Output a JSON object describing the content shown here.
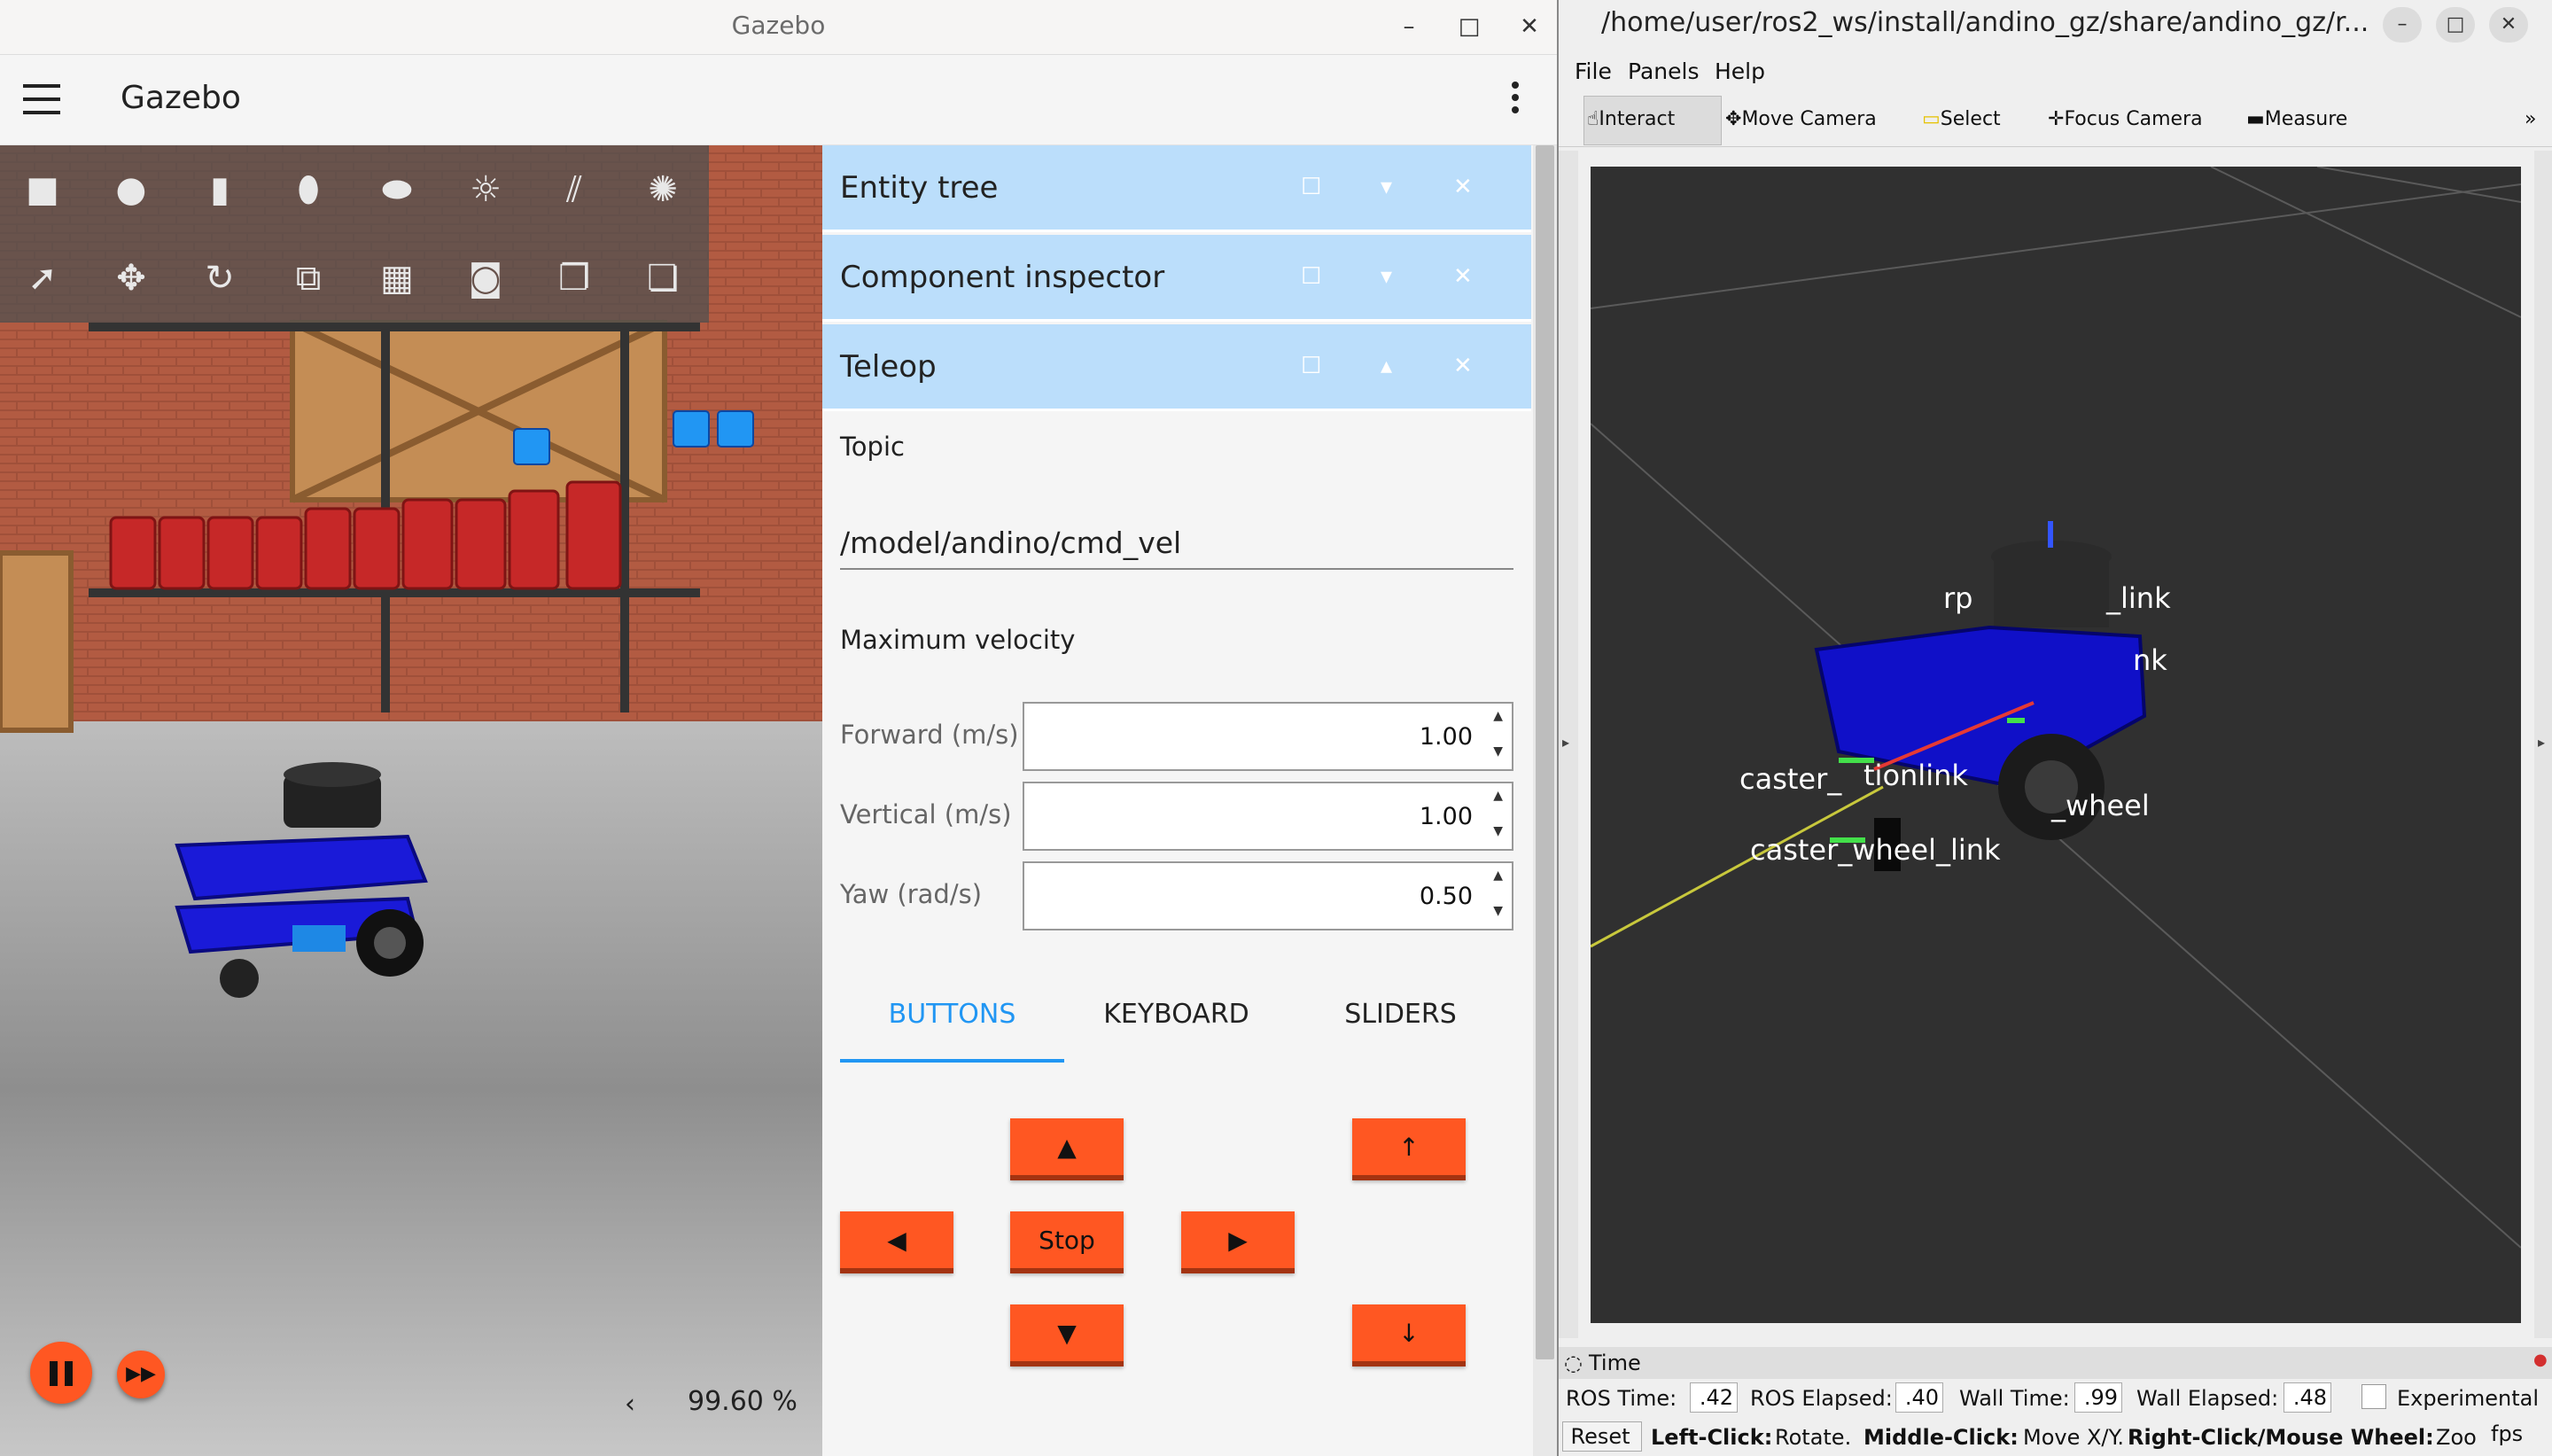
{
  "gazebo": {
    "window_title": "Gazebo",
    "app_title": "Gazebo",
    "window_controls": {
      "minimize": "–",
      "maximize": "□",
      "close": "✕"
    },
    "scene": {
      "real_time_factor": "99.60 %"
    },
    "docks": [
      {
        "label": "Entity tree"
      },
      {
        "label": "Component inspector"
      },
      {
        "label": "Teleop"
      }
    ],
    "teleop": {
      "topic_label": "Topic",
      "topic_value": "/model/andino/cmd_vel",
      "max_velocity_label": "Maximum velocity",
      "fields": [
        {
          "label": "Forward (m/s)",
          "value": "1.00"
        },
        {
          "label": "Vertical (m/s)",
          "value": "1.00"
        },
        {
          "label": "Yaw (rad/s)",
          "value": "0.50"
        }
      ],
      "tabs": [
        "BUTTONS",
        "KEYBOARD",
        "SLIDERS"
      ],
      "active_tab": "BUTTONS",
      "buttons": {
        "forward": "▲",
        "left": "◀",
        "stop": "Stop",
        "right": "▶",
        "backward": "▼",
        "up": "↑",
        "down": "↓"
      }
    }
  },
  "rviz": {
    "window_title": "/home/user/ros2_ws/install/andino_gz/share/andino_gz/r...",
    "menus": [
      "File",
      "Panels",
      "Help"
    ],
    "tools": [
      "Interact",
      "Move Camera",
      "Select",
      "Focus Camera",
      "Measure"
    ],
    "tools_overflow": "»",
    "frame_labels": [
      "rp",
      "_link",
      "nk",
      "caster_",
      "tionlink",
      "caster_wheel_link",
      "_wheel"
    ],
    "time_panel": {
      "title": "Time",
      "ros_time_label": "ROS Time:",
      "ros_time": ".42",
      "ros_elapsed_label": "ROS Elapsed:",
      "ros_elapsed": ".40",
      "wall_time_label": "Wall Time:",
      "wall_time": ".99",
      "wall_elapsed_label": "Wall Elapsed:",
      "wall_elapsed": ".48",
      "experimental_label": "Experimental",
      "reset_label": "Reset",
      "help_left_bold": "Left-Click:",
      "help_left": "Rotate.",
      "help_middle_bold": "Middle-Click:",
      "help_middle": "Move X/Y.",
      "help_right_bold": "Right-Click/Mouse Wheel:",
      "help_right": "Zoo",
      "fps": "fps"
    }
  }
}
